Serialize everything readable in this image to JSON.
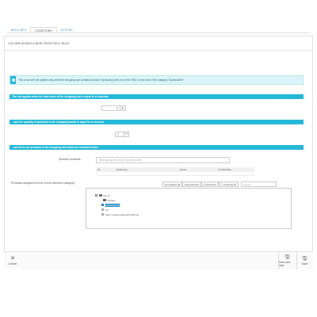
{
  "header": {
    "title": "YOU ARE ADDING A NEW CROSS SELL RULE"
  },
  "tabs": [
    {
      "label": "BASIC INFO",
      "active": false
    },
    {
      "label": "CONDITIONS",
      "active": true
    },
    {
      "label": "ACTIONS",
      "active": false
    }
  ],
  "alert": {
    "icon": "info-icon",
    "text": "This cross sell rule applies only when the shopping cart contains at least X product(s) with one of the SKU or from one of the category \"Accessories\""
  },
  "sections": {
    "total_value": "The rule applies when the total value of the shopping cart is equal to or exceeds:",
    "quantity": "...and the quantity of products in the shopping basket is equal to or exceeds:",
    "products": "...and there are products in the shopping cart which are included below:"
  },
  "inputs": {
    "total_value": "0",
    "total_suffix": "€",
    "quantity": "1",
    "quantity_spin": "▲▼"
  },
  "specific_products": {
    "label": "Specific products:",
    "placeholder": "Start typing the name or product code",
    "columns": [
      "ID",
      "Reference",
      "Name",
      "Combination"
    ]
  },
  "category_tree": {
    "label": "Products assigned to one of the selected category:",
    "toolbar": [
      "Collapse All",
      "Expand All",
      "Check All",
      "Uncheck All"
    ],
    "search_placeholder": "search...",
    "items": [
      {
        "label": "Home",
        "control": "checkbox",
        "checked": false,
        "folder": true
      },
      {
        "label": "Clothes",
        "control": "none",
        "checked": false,
        "folder": true
      },
      {
        "label": "Accessories",
        "control": "checkbox",
        "checked": true,
        "folder": false,
        "highlighted": true
      },
      {
        "label": "Art",
        "control": "radio",
        "checked": false,
        "folder": false
      },
      {
        "label": "Sport i regeneracyjnePodstrona",
        "control": "radio",
        "checked": false,
        "folder": false
      }
    ]
  },
  "footer": {
    "cancel": "Cancel",
    "save_and_stay": "Save and stay",
    "save": "Save"
  },
  "colors": {
    "accent": "#25b9d7",
    "alert_bg": "#dcf4f9",
    "checked": "#2a7bc0"
  }
}
